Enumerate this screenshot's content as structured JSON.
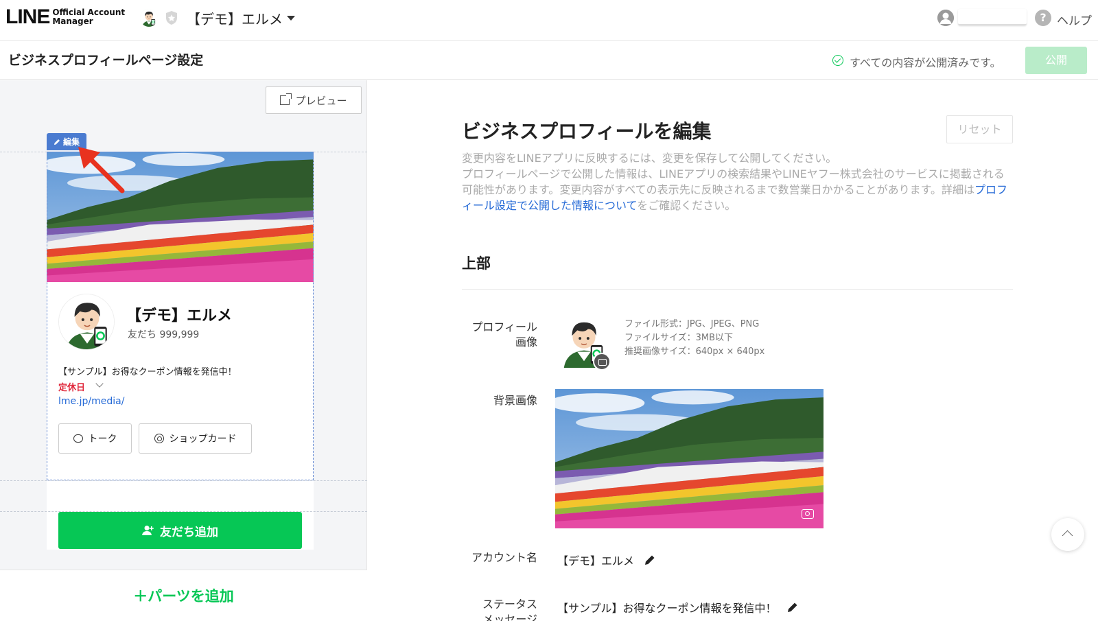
{
  "header": {
    "logo_main": "LINE",
    "logo_sub_1": "Official Account",
    "logo_sub_2": "Manager",
    "account_name": "【デモ】エルメ",
    "help_label": "ヘルプ"
  },
  "pagebar": {
    "title": "ビジネスプロフィールページ設定",
    "status_text": "すべての内容が公開済みです。",
    "publish_label": "公開"
  },
  "preview": {
    "preview_button_label": "プレビュー",
    "edit_tab_label": "編集",
    "profile_name": "【デモ】エルメ",
    "friends_count": "友だち 999,999",
    "status_message": "【サンプル】お得なクーポン情報を発信中！",
    "holiday_label": "定休日",
    "link": "lme.jp/media/",
    "talk_button": "トーク",
    "shopcard_button": "ショップカード",
    "add_friend_button": "友だち追加",
    "add_parts_label": "＋パーツを追加"
  },
  "editor": {
    "title": "ビジネスプロフィールを編集",
    "reset_label": "リセット",
    "desc_1": "変更内容をLINEアプリに反映するには、変更を保存して公開してください。",
    "desc_2": "プロフィールページで公開した情報は、LINEアプリの検索結果やLINEヤフー株式会社のサービスに掲載される可能性があります。変更内容がすべての表示先に反映されるまで数営業日かかることがあります。詳細は",
    "desc_link": "プロフィール設定で公開した情報について",
    "desc_3": "をご確認ください。",
    "section_title": "上部",
    "profile_image_label_1": "プロフィール",
    "profile_image_label_2": "画像",
    "file_format": "ファイル形式：JPG、JPEG、PNG",
    "file_size": "ファイルサイズ：3MB以下",
    "recommended_size": "推奨画像サイズ：640px × 640px",
    "background_label": "背景画像",
    "account_name_label": "アカウント名",
    "account_name_value": "【デモ】エルメ",
    "status_label_1": "ステータス",
    "status_label_2": "メッセージ",
    "status_value": "【サンプル】お得なクーポン情報を発信中！"
  },
  "colors": {
    "brand_green": "#06c755",
    "link_blue": "#2469d6",
    "edit_blue": "#4a7bd0",
    "holiday_red": "#e0283c",
    "arrow_red": "#e8321f"
  },
  "icons": [
    "shield-icon",
    "caret-down-icon",
    "user-avatar-icon",
    "help-icon",
    "check-circle-icon",
    "external-link-icon",
    "pencil-icon",
    "chat-icon",
    "shopcard-icon",
    "add-user-icon",
    "camera-icon",
    "chevron-up-icon",
    "arrow-icon"
  ]
}
